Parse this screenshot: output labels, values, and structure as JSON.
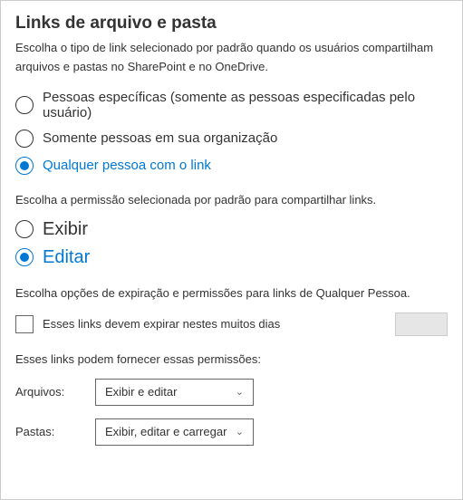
{
  "heading": "Links de arquivo e pasta",
  "description": "Escolha o tipo de link selecionado por padrão quando os usuários compartilham arquivos e pastas no SharePoint e no OneDrive.",
  "linkTypeOptions": [
    {
      "label": "Pessoas específicas (somente as pessoas especificadas pelo usuário)",
      "selected": false
    },
    {
      "label": "Somente pessoas em sua organização",
      "selected": false
    },
    {
      "label": "Qualquer pessoa com o link",
      "selected": true
    }
  ],
  "permissionPrompt": "Escolha a permissão selecionada por padrão para compartilhar links.",
  "permissionOptions": [
    {
      "label": "Exibir",
      "selected": false
    },
    {
      "label": "Editar",
      "selected": true
    }
  ],
  "expirationPrompt": "Escolha opções de expiração e permissões para links de Qualquer Pessoa.",
  "expirationCheckboxLabel": "Esses links devem expirar nestes muitos dias",
  "expirationDays": "",
  "permissionsHeader": "Esses links podem fornecer essas permissões:",
  "filesLabel": "Arquivos:",
  "filesDropdown": "Exibir e editar",
  "foldersLabel": "Pastas:",
  "foldersDropdown": "Exibir, editar e carregar"
}
